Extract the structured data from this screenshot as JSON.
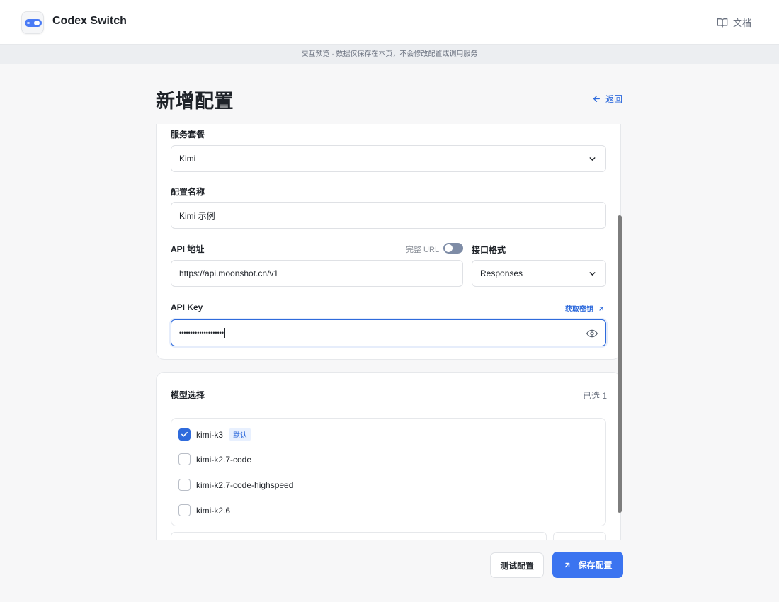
{
  "header": {
    "app_title": "Codex Switch",
    "logo_icon": "toggle-logo-icon",
    "docs_label": "文档",
    "docs_icon": "book-icon"
  },
  "notice": {
    "text": "交互预览 · 数据仅保存在本页，不会修改配置或调用服务"
  },
  "page": {
    "title": "新增配置",
    "back_label": "返回",
    "back_icon": "arrow-left-icon"
  },
  "form": {
    "service_plan": {
      "label": "服务套餐",
      "value": "Kimi"
    },
    "config_name": {
      "label": "配置名称",
      "value": "Kimi 示例"
    },
    "api_address": {
      "label": "API 地址",
      "value": "https://api.moonshot.cn/v1",
      "full_url_toggle_label": "完整 URL",
      "full_url_enabled": false
    },
    "api_format": {
      "label": "接口格式",
      "value": "Responses"
    },
    "api_key": {
      "label": "API Key",
      "masked_value": "••••••••••••••••••••",
      "get_key_label": "获取密钥",
      "eye_icon": "eye-icon"
    }
  },
  "models": {
    "section_title": "模型选择",
    "selected_count": "已选 1",
    "items": [
      {
        "name": "kimi-k3",
        "checked": true,
        "badge": "默认"
      },
      {
        "name": "kimi-k2.7-code",
        "checked": false
      },
      {
        "name": "kimi-k2.7-code-highspeed",
        "checked": false
      },
      {
        "name": "kimi-k2.6",
        "checked": false
      }
    ]
  },
  "actions": {
    "test_label": "测试配置",
    "save_label": "保存配置",
    "save_icon": "arrow-up-right-icon"
  },
  "colors": {
    "accent": "#3b74f0",
    "link": "#2f6bdc",
    "badge_bg": "#e8f0fe",
    "toggle_off": "#7e8ca6"
  }
}
